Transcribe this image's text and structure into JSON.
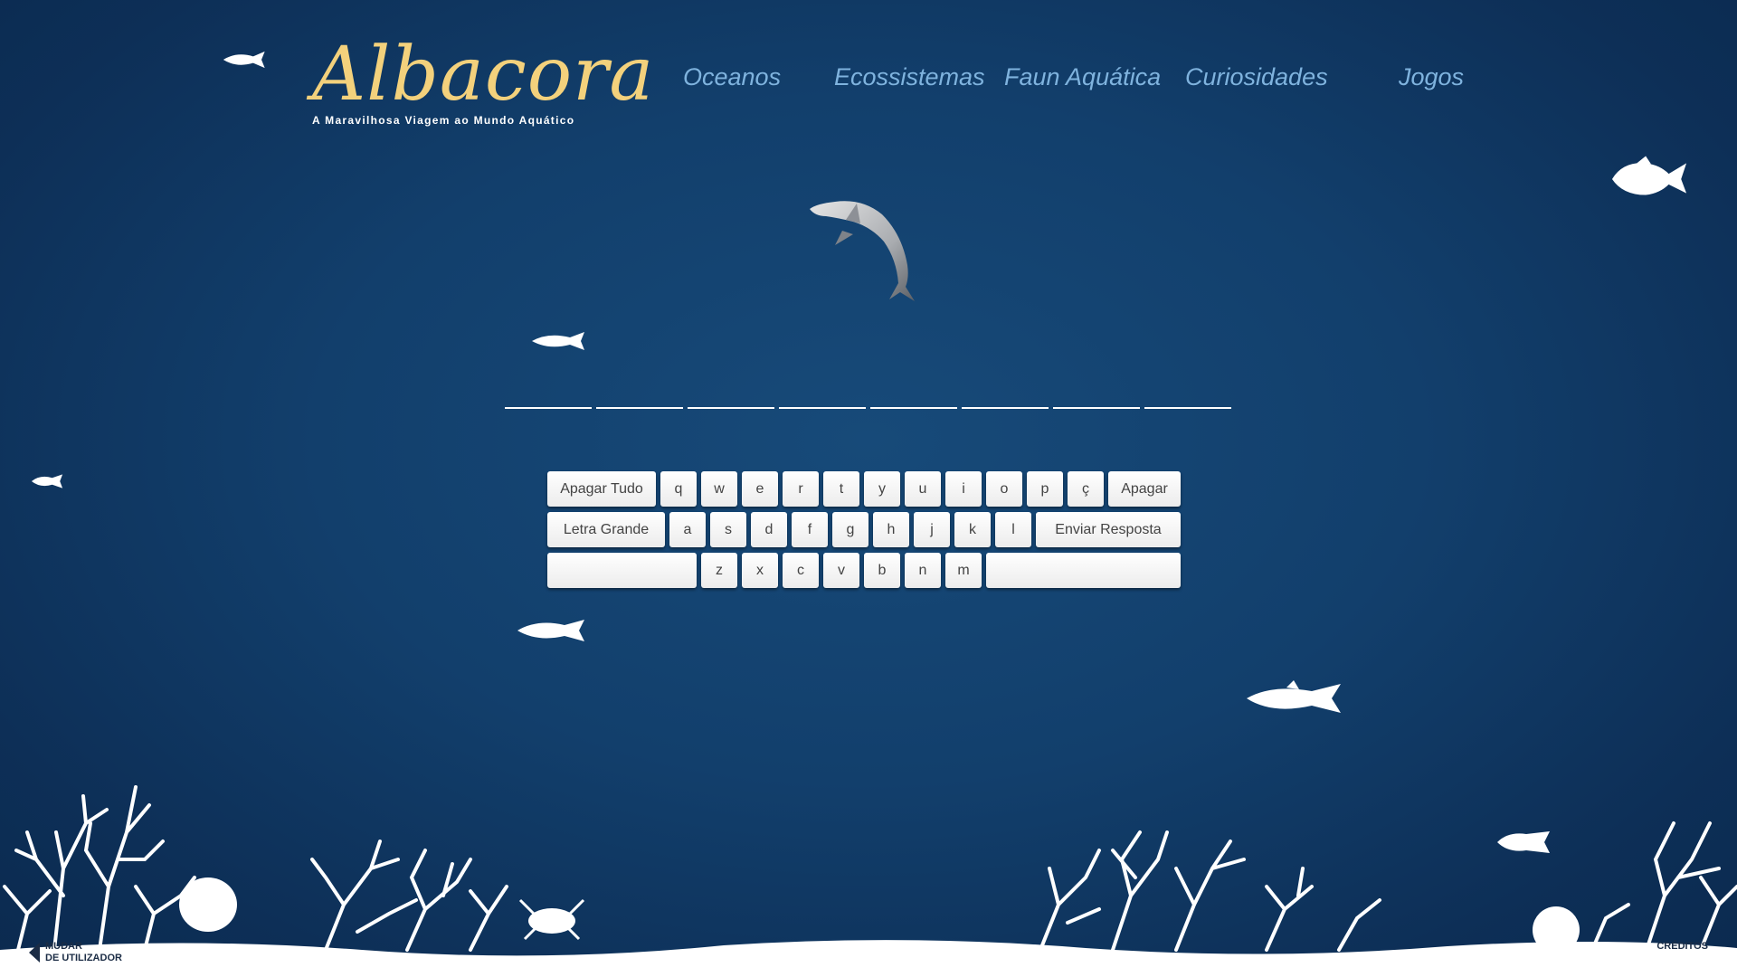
{
  "logo": {
    "title": "Albacora",
    "subtitle": "A Maravilhosa Viagem ao Mundo Aquático"
  },
  "nav": {
    "items": [
      {
        "label": "Oceanos"
      },
      {
        "label": "Ecossistemas"
      },
      {
        "label": "Faun Aquática"
      },
      {
        "label": "Curiosidades"
      },
      {
        "label": "Jogos"
      }
    ]
  },
  "keyboard": {
    "row1": [
      "Apagar Tudo",
      "q",
      "w",
      "e",
      "r",
      "t",
      "y",
      "u",
      "i",
      "o",
      "p",
      "ç",
      "Apagar"
    ],
    "row2": [
      "Letra Grande",
      "a",
      "s",
      "d",
      "f",
      "g",
      "h",
      "j",
      "k",
      "l",
      "Enviar Resposta"
    ],
    "row3": [
      "",
      "z",
      "x",
      "c",
      "v",
      "b",
      "n",
      "m",
      ""
    ]
  },
  "footer": {
    "change_user_line1": "MUDAR",
    "change_user_line2": "DE UTILIZADOR",
    "credits": "CRÉDITOS"
  },
  "colors": {
    "background": "#123f6c",
    "logo": "#f3d17c",
    "nav": "#7fb3de"
  }
}
